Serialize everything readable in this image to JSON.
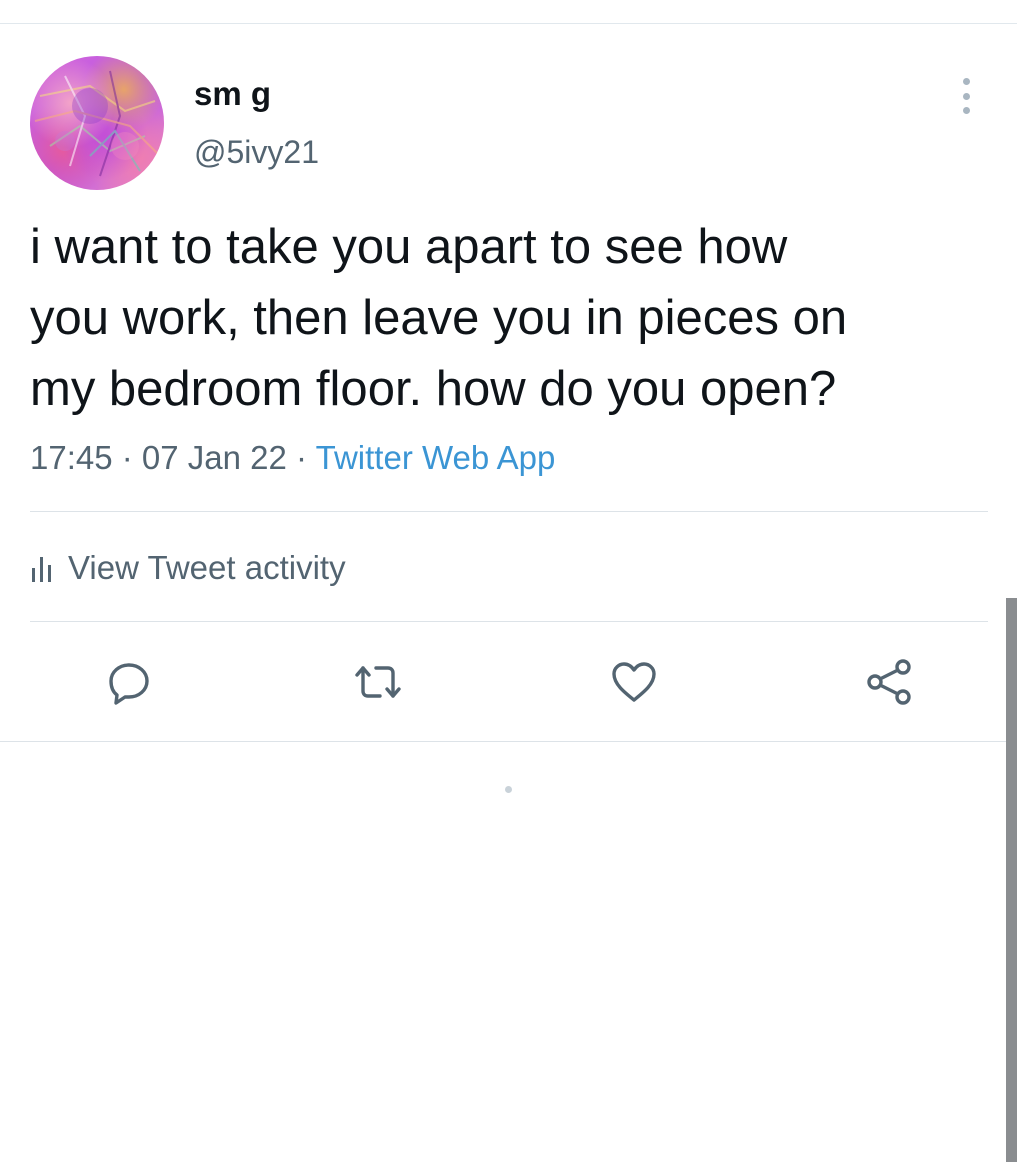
{
  "tweet": {
    "author": {
      "display_name": "sm g",
      "handle": "@5ivy21"
    },
    "text_lines": [
      "i want to take you apart to see how",
      "you work, then leave you in pieces on",
      "my bedroom floor. how do you open?"
    ],
    "time": "17:45",
    "date": "07 Jan 22",
    "separator": " · ",
    "source": "Twitter Web App"
  },
  "activity": {
    "label": "View Tweet activity",
    "icon": "bar-chart-icon"
  },
  "actions": [
    {
      "name": "reply",
      "icon": "speech-bubble-icon"
    },
    {
      "name": "retweet",
      "icon": "retweet-arrows-icon"
    },
    {
      "name": "like",
      "icon": "heart-icon"
    },
    {
      "name": "share",
      "icon": "share-nodes-icon"
    }
  ],
  "colors": {
    "text": "#0f1419",
    "secondary": "#536471",
    "link": "#3b95d4",
    "divider": "#dde3e8"
  }
}
